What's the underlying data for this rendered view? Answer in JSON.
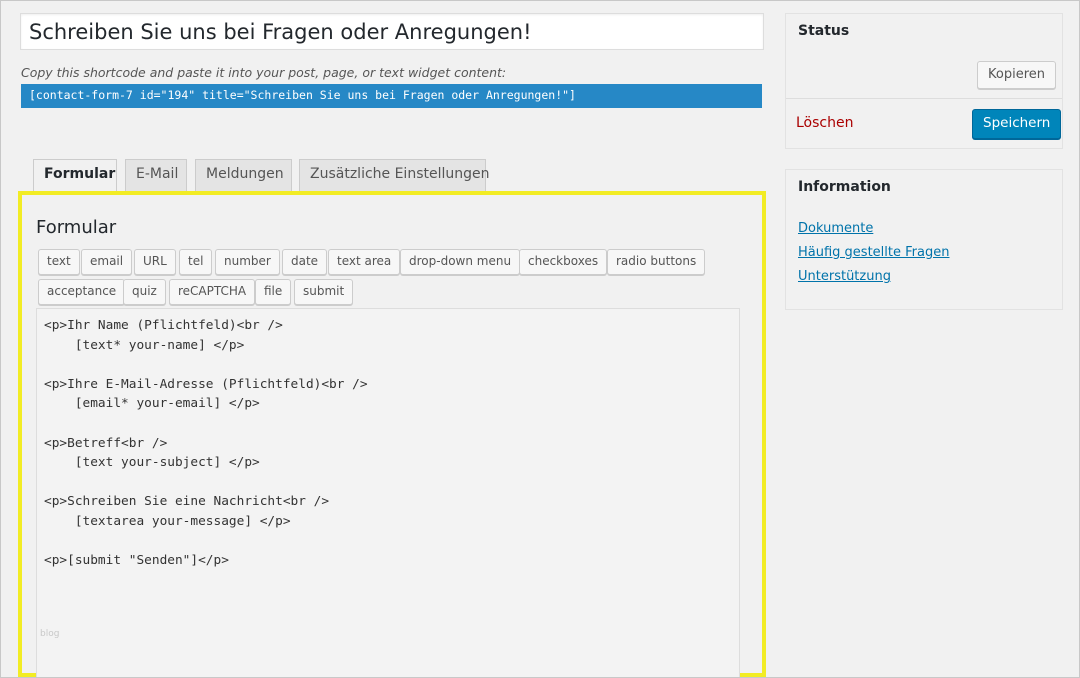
{
  "form": {
    "title_value": "Schreiben Sie uns bei Fragen oder Anregungen!",
    "shortcode_hint": "Copy this shortcode and paste it into your post, page, or text widget content:",
    "shortcode": "[contact-form-7 id=\"194\" title=\"Schreiben Sie uns bei Fragen oder Anregungen!\"]"
  },
  "tabs": [
    {
      "label": "Formular",
      "active": true
    },
    {
      "label": "E-Mail",
      "active": false
    },
    {
      "label": "Meldungen",
      "active": false
    },
    {
      "label": "Zusätzliche Einstellungen",
      "active": false
    }
  ],
  "panel": {
    "title": "Formular",
    "tag_buttons": [
      "text",
      "email",
      "URL",
      "tel",
      "number",
      "date",
      "text area",
      "drop-down menu",
      "checkboxes",
      "radio buttons",
      "acceptance",
      "quiz",
      "reCAPTCHA",
      "file",
      "submit"
    ],
    "editor_content": "<p>Ihr Name (Pflichtfeld)<br />\n    [text* your-name] </p>\n\n<p>Ihre E-Mail-Adresse (Pflichtfeld)<br />\n    [email* your-email] </p>\n\n<p>Betreff<br />\n    [text your-subject] </p>\n\n<p>Schreiben Sie eine Nachricht<br />\n    [textarea your-message] </p>\n\n<p>[submit \"Senden\"]</p>",
    "watermark": "blog",
    "highlight_color": "#f2ec24"
  },
  "status_box": {
    "heading": "Status",
    "copy_label": "Kopieren",
    "delete_label": "Löschen",
    "save_label": "Speichern"
  },
  "info_box": {
    "heading": "Information",
    "links": [
      "Dokumente",
      "Häufig gestellte Fragen",
      "Unterstützung"
    ]
  },
  "colors": {
    "shortcode_bg": "#2688c6",
    "primary_button": "#0085ba",
    "delete_link": "#a00000",
    "link": "#0073aa"
  }
}
